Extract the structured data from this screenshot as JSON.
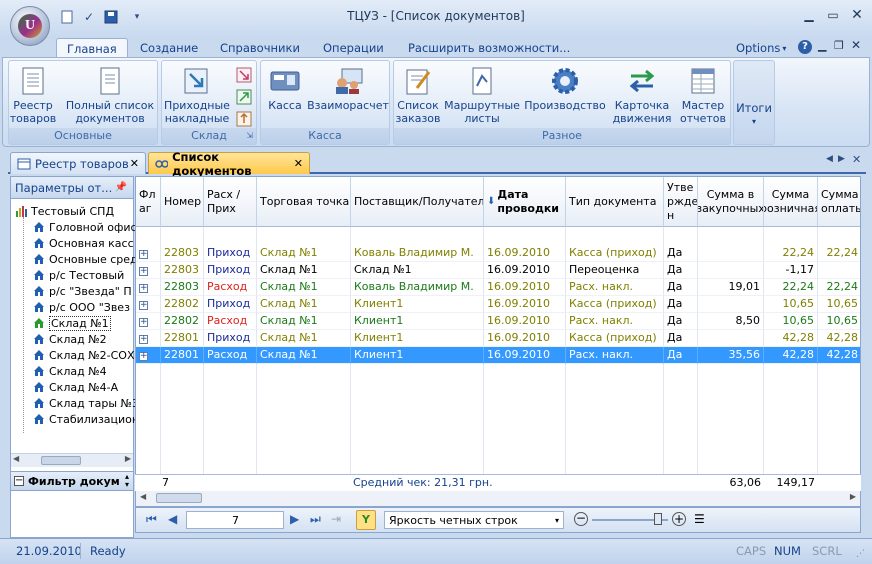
{
  "window": {
    "title": "ТЦУЗ - [Список документов]"
  },
  "ribbon": {
    "tabs": [
      "Главная",
      "Создание",
      "Справочники",
      "Операции",
      "Расширить возможности..."
    ],
    "options_label": "Options",
    "groups": {
      "basic": {
        "label": "Основные",
        "buttons": [
          "Реестр\nтоваров",
          "Полный список\nдокументов"
        ]
      },
      "warehouse": {
        "label": "Склад",
        "buttons": [
          "Приходные\nнакладные"
        ]
      },
      "cash": {
        "label": "Касса",
        "buttons": [
          "Касса",
          "Взаиморасчет"
        ]
      },
      "misc": {
        "label": "Разное",
        "buttons": [
          "Список\nзаказов",
          "Маршрутные\nлисты",
          "Производство",
          "Карточка\nдвижения",
          "Мастер\nотчетов"
        ]
      },
      "totals": {
        "label": "Итоги"
      }
    }
  },
  "doc_tabs": [
    {
      "label": "Реестр товаров",
      "active": false
    },
    {
      "label": "Список документов",
      "active": true
    }
  ],
  "left_panel": {
    "title": "Параметры от...",
    "tree": [
      "Тестовый СПД",
      "Головной офис",
      "Основная касс",
      "Основные сред",
      "р/с  Тестовый",
      "р/с \"Звезда\" П",
      "р/с ООО \"Звез",
      "Склад №1",
      "Склад №2",
      "Склад №2-СОХ",
      "Склад №4",
      "Склад №4-А",
      "Склад тары №3",
      "Стабилизацион"
    ],
    "filter_label": "Фильтр докум"
  },
  "grid": {
    "columns": [
      "Фл\nаг",
      "Номер",
      "Расх /\nПрих",
      "Торговая точка",
      "Поставщик/Получатель",
      "Дата\nпроводки",
      "Тип документа",
      "Утве\nржде\nн",
      "Сумма в\nзакупочных",
      "Сумма\nрозничная",
      "Сумма\nоплаты"
    ],
    "rows": [
      {
        "num": "22803",
        "dir": "Приход",
        "point": "Склад №1",
        "party": "Коваль Владимир М.",
        "date": "16.09.2010",
        "type": "Касса (приход)",
        "ok": "Да",
        "buy": "",
        "retail": "22,24",
        "paid": "22,24",
        "style": "olive"
      },
      {
        "num": "22803",
        "dir": "Приход",
        "point": "Склад №1",
        "party": "Склад №1",
        "date": "16.09.2010",
        "type": "Переоценка",
        "ok": "Да",
        "buy": "",
        "retail": "-1,17",
        "paid": "",
        "style": "black"
      },
      {
        "num": "22803",
        "dir": "Расход",
        "point": "Склад №1",
        "party": "Коваль Владимир М.",
        "date": "16.09.2010",
        "type": "Расх. накл.",
        "ok": "Да",
        "buy": "19,01",
        "retail": "22,24",
        "paid": "22,24",
        "style": "green"
      },
      {
        "num": "22802",
        "dir": "Приход",
        "point": "Склад №1",
        "party": "Клиент1",
        "date": "16.09.2010",
        "type": "Касса (приход)",
        "ok": "Да",
        "buy": "",
        "retail": "10,65",
        "paid": "10,65",
        "style": "olive"
      },
      {
        "num": "22802",
        "dir": "Расход",
        "point": "Склад №1",
        "party": "Клиент1",
        "date": "16.09.2010",
        "type": "Расх. накл.",
        "ok": "Да",
        "buy": "8,50",
        "retail": "10,65",
        "paid": "10,65",
        "style": "green"
      },
      {
        "num": "22801",
        "dir": "Приход",
        "point": "Склад №1",
        "party": "Клиент1",
        "date": "16.09.2010",
        "type": "Касса (приход)",
        "ok": "Да",
        "buy": "",
        "retail": "42,28",
        "paid": "42,28",
        "style": "olive"
      },
      {
        "num": "22801",
        "dir": "Расход",
        "point": "Склад №1",
        "party": "Клиент1",
        "date": "16.09.2010",
        "type": "Расх. накл.",
        "ok": "Да",
        "buy": "35,56",
        "retail": "42,28",
        "paid": "42,28",
        "style": "selected"
      }
    ],
    "footer": {
      "count": "7",
      "avg": "Средний чек: 21,31 грн.",
      "buy_total": "63,06",
      "retail_total": "149,17"
    }
  },
  "navigator": {
    "record": "7",
    "style_select": "Яркость четных строк"
  },
  "status": {
    "date": "21.09.2010",
    "state": "Ready",
    "caps": "CAPS",
    "num": "NUM",
    "scrl": "SCRL"
  },
  "colors": {
    "accent": "#15428b",
    "selection": "#3399ff",
    "olive": "#808000",
    "green": "#1a7a1a",
    "red": "#e0201c",
    "blue": "#1a2a9a"
  }
}
